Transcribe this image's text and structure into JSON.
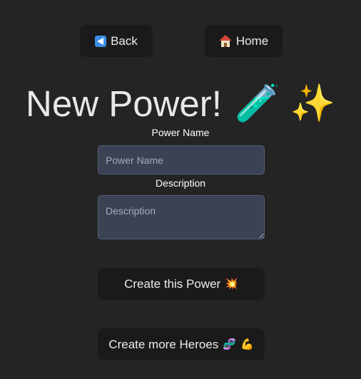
{
  "nav": {
    "back_label": "Back",
    "home_label": "Home"
  },
  "header": {
    "title": "New Power!",
    "title_icon_1": "🧪",
    "title_icon_2": "✨"
  },
  "form": {
    "name_label": "Power Name",
    "name_placeholder": "Power Name",
    "name_value": "",
    "description_label": "Description",
    "description_placeholder": "Description",
    "description_value": ""
  },
  "actions": {
    "create_power_label": "Create this Power",
    "create_power_icon": "💥",
    "create_heroes_label": "Create more Heroes",
    "create_heroes_icon_1": "🧬",
    "create_heroes_icon_2": "💪"
  },
  "icons": {
    "back": "back-arrow-icon",
    "home": "house-icon"
  },
  "colors": {
    "background": "#242424",
    "button_bg": "#1a1a1a",
    "field_bg": "#3a4254",
    "back_icon": "#3b8ee8"
  }
}
